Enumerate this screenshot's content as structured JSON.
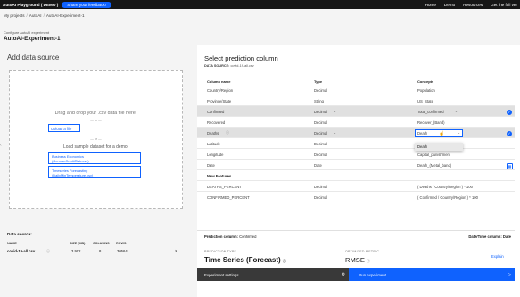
{
  "topbar": {
    "brand": "AutoAI Playground ( DEMO )",
    "feedback": "Share your feedback!",
    "nav": [
      "Home",
      "Demo",
      "Resources",
      "Get the full ver"
    ]
  },
  "breadcrumb": [
    "My projects",
    "AutoAI",
    "AutoAI-Experiment-1"
  ],
  "page": {
    "subtitle": "Configure AutoAI experiment",
    "title": "AutoAI-Experiment-1"
  },
  "left": {
    "heading": "Add data source",
    "drop_text": "Drag and drop your .csv data file here.",
    "or": "— or —",
    "upload": "Upload a file",
    "load_sample": "Load sample dataset for a demo:",
    "samples": [
      [
        "Business Economics",
        "(GermanCreditRisk.csv)"
      ],
      [
        "Timeseries Forecasting",
        "(DailyMinTemperature.csv)"
      ]
    ],
    "datasource_label": "Data source:",
    "ds_headers": {
      "name": "NAME",
      "size": "SIZE (MB)",
      "columns": "COLUMNS",
      "rows": "ROWS"
    },
    "ds_row": {
      "name": "covid-19-all.csv",
      "size": "3.902",
      "columns": "8",
      "rows": "30564",
      "close": "×"
    }
  },
  "right": {
    "heading": "Select prediction column",
    "source_label": "DATA SOURCE:",
    "source_value": "covid-19-all.csv",
    "headers": {
      "column": "Column name",
      "type": "Type",
      "concepts": "Concepts"
    },
    "rows": [
      {
        "name": "Country/Region",
        "type": "Decimal",
        "concept": "Population"
      },
      {
        "name": "Province/State",
        "type": "String",
        "concept": "US_State"
      },
      {
        "name": "Confirmed",
        "type": "Decimal",
        "concept": "Total_confirmed"
      },
      {
        "name": "Recovered",
        "type": "Decimal",
        "concept": "Recover_(Band)"
      },
      {
        "name": "Deaths",
        "type": "Decimal",
        "concept": "Death"
      },
      {
        "name": "Latitude",
        "type": "Decimal",
        "concept": ""
      },
      {
        "name": "Longitude",
        "type": "Decimal",
        "concept": "Capital_punishment"
      },
      {
        "name": "Date",
        "type": "Date",
        "concept": "Death_(Metal_band)"
      }
    ],
    "new_features_label": "New Features",
    "new_features": [
      {
        "name": "DEATHS_PERCENT",
        "type": "Decimal",
        "concept": "( Deaths / Country/Region ) * 100"
      },
      {
        "name": "CONFIRMED_PERCENT",
        "type": "Decimal",
        "concept": "( Confirmed / Country/Region ) * 100"
      }
    ],
    "dropdown_option": "Death",
    "prediction_column_label": "Prediction column:",
    "prediction_column_value": "Confirmed",
    "date_time_label": "Date/Time column:",
    "date_time_value": "Date",
    "prediction_type_label": "PREDICTION TYPE",
    "prediction_type": "Time Series (Forecast)",
    "metric_label": "OPTIMIZED METRIC",
    "metric": "RMSE",
    "explain": "Explain"
  },
  "footer": {
    "settings": "Experiment settings",
    "run": "Run experiment"
  },
  "colors": {
    "accent": "#0f62fe",
    "topbar": "#161616",
    "footer_dark": "#393939"
  }
}
